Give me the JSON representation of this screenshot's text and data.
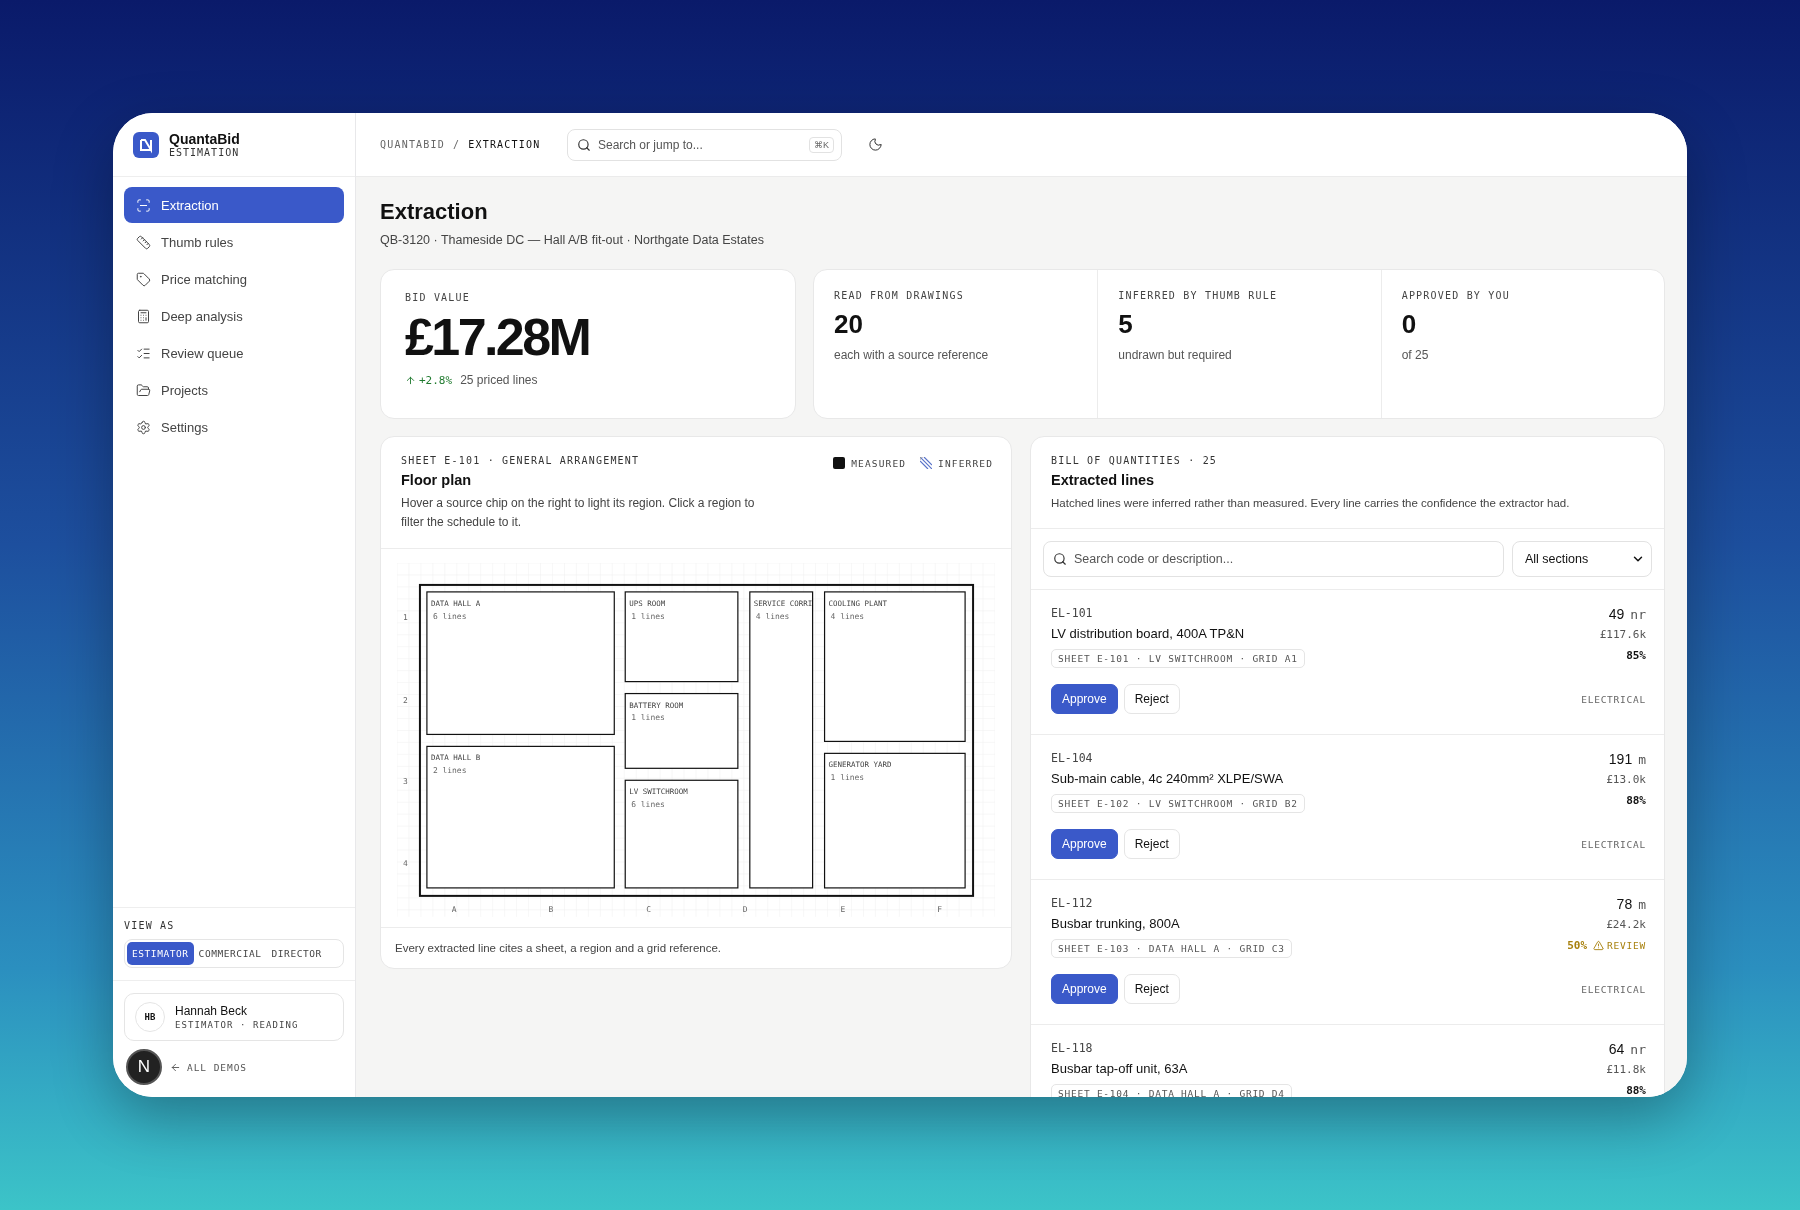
{
  "brand": {
    "name": "QuantaBid",
    "subtitle": "ESTIMATION"
  },
  "nav": [
    {
      "label": "Extraction",
      "selected": true
    },
    {
      "label": "Thumb rules",
      "selected": false
    },
    {
      "label": "Price matching",
      "selected": false
    },
    {
      "label": "Deep analysis",
      "selected": false
    },
    {
      "label": "Review queue",
      "selected": false
    },
    {
      "label": "Projects",
      "selected": false
    },
    {
      "label": "Settings",
      "selected": false
    }
  ],
  "view_as": {
    "label": "VIEW AS",
    "options": [
      {
        "label": "ESTIMATOR",
        "selected": true
      },
      {
        "label": "COMMERCIAL",
        "selected": false
      },
      {
        "label": "DIRECTOR",
        "selected": false
      }
    ]
  },
  "user": {
    "initials": "HB",
    "name": "Hannah Beck",
    "role": "ESTIMATOR · READING"
  },
  "back_link": "ALL DEMOS",
  "dev_badge": "N",
  "header": {
    "breadcrumb": [
      "QUANTABID",
      "EXTRACTION"
    ],
    "separator": "/",
    "search": {
      "placeholder": "Search or jump to...",
      "shortcut": "⌘K"
    }
  },
  "page": {
    "title": "Extraction",
    "subtitle": "QB-3120 · Thameside DC — Hall A/B fit-out · Northgate Data Estates"
  },
  "bid": {
    "label": "BID VALUE",
    "value": "£17.28M",
    "delta": "+2.8%",
    "note": "25 priced lines"
  },
  "stats": [
    {
      "label": "READ FROM DRAWINGS",
      "value": "20",
      "note": "each with a source reference"
    },
    {
      "label": "INFERRED BY THUMB RULE",
      "value": "5",
      "note": "undrawn but required"
    },
    {
      "label": "APPROVED BY YOU",
      "value": "0",
      "note": "of 25"
    }
  ],
  "floor_plan": {
    "eyebrow": "SHEET E-101 · GENERAL ARRANGEMENT",
    "title": "Floor plan",
    "description": "Hover a source chip on the right to light its region. Click a region to filter the schedule to it.",
    "legend": [
      {
        "label": "MEASURED",
        "kind": "solid"
      },
      {
        "label": "INFERRED",
        "kind": "hatched"
      }
    ],
    "rooms": [
      {
        "name": "DATA HALL A",
        "lines": "6 lines"
      },
      {
        "name": "DATA HALL B",
        "lines": "2 lines"
      },
      {
        "name": "UPS ROOM",
        "lines": "1 lines"
      },
      {
        "name": "BATTERY ROOM",
        "lines": "1 lines"
      },
      {
        "name": "LV SWITCHROOM",
        "lines": "6 lines"
      },
      {
        "name": "SERVICE CORRI",
        "lines": "4 lines"
      },
      {
        "name": "COOLING PLANT",
        "lines": "4 lines"
      },
      {
        "name": "GENERATOR YARD",
        "lines": "1 lines"
      }
    ],
    "rows": [
      "1",
      "2",
      "3",
      "4"
    ],
    "columns": [
      "A",
      "B",
      "C",
      "D",
      "E",
      "F"
    ],
    "footer": "Every extracted line cites a sheet, a region and a grid reference."
  },
  "boq": {
    "eyebrow": "BILL OF QUANTITIES · 25",
    "title": "Extracted lines",
    "description": "Hatched lines were inferred rather than measured. Every line carries the confidence the extractor had.",
    "search": {
      "placeholder": "Search code or description..."
    },
    "filter": "All sections",
    "items": [
      {
        "code": "EL-101",
        "description": "LV distribution board, 400A TP&N",
        "source": "SHEET E-101 · LV SWITCHROOM · GRID A1",
        "qty": "49",
        "unit": "nr",
        "price": "£117.6k",
        "confidence": "85%",
        "review": false,
        "buttons": [
          {
            "label": "Approve",
            "kind": "primary"
          },
          {
            "label": "Reject",
            "kind": "secondary"
          }
        ],
        "section": "ELECTRICAL"
      },
      {
        "code": "EL-104",
        "description": "Sub-main cable, 4c 240mm² XLPE/SWA",
        "source": "SHEET E-102 · LV SWITCHROOM · GRID B2",
        "qty": "191",
        "unit": "m",
        "price": "£13.0k",
        "confidence": "88%",
        "review": false,
        "buttons": [
          {
            "label": "Approve",
            "kind": "primary"
          },
          {
            "label": "Reject",
            "kind": "secondary"
          }
        ],
        "section": "ELECTRICAL"
      },
      {
        "code": "EL-112",
        "description": "Busbar trunking, 800A",
        "source": "SHEET E-103 · DATA HALL A · GRID C3",
        "qty": "78",
        "unit": "m",
        "price": "£24.2k",
        "confidence": "50%",
        "review": true,
        "review_label": "REVIEW",
        "buttons": [
          {
            "label": "Approve",
            "kind": "primary"
          },
          {
            "label": "Reject",
            "kind": "secondary"
          }
        ],
        "section": "ELECTRICAL"
      },
      {
        "code": "EL-118",
        "description": "Busbar tap-off unit, 63A",
        "source": "SHEET E-104 · DATA HALL A · GRID D4",
        "qty": "64",
        "unit": "nr",
        "price": "£11.8k",
        "confidence": "88%",
        "review": false
      }
    ]
  }
}
